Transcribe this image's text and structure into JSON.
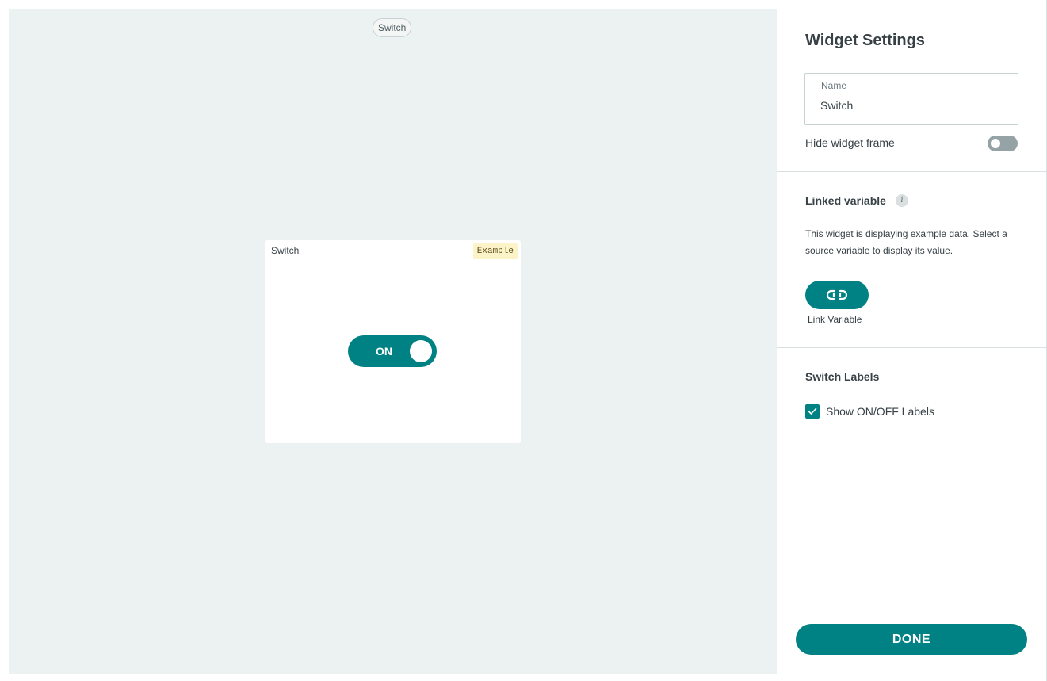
{
  "canvas": {
    "chip_label": "Switch",
    "widget": {
      "title": "Switch",
      "badge": "Example",
      "switch_label": "ON",
      "switch_state": "on"
    }
  },
  "panel": {
    "title": "Widget Settings",
    "name_field": {
      "label": "Name",
      "value": "Switch"
    },
    "hide_frame": {
      "label": "Hide widget frame",
      "enabled": false
    },
    "linked_variable": {
      "title": "Linked variable",
      "info_icon": "i",
      "description": "This widget is displaying example data. Select a source variable to display its value.",
      "button_icon": "link-icon",
      "button_label": "Link Variable"
    },
    "switch_labels": {
      "title": "Switch Labels",
      "checkbox_label": "Show ON/OFF Labels",
      "checked": true
    },
    "done_label": "DONE"
  },
  "colors": {
    "accent": "#008184",
    "canvas_bg": "#ecf1f1",
    "badge_bg": "#fdf3c8",
    "toggle_off": "#95a3a6"
  }
}
